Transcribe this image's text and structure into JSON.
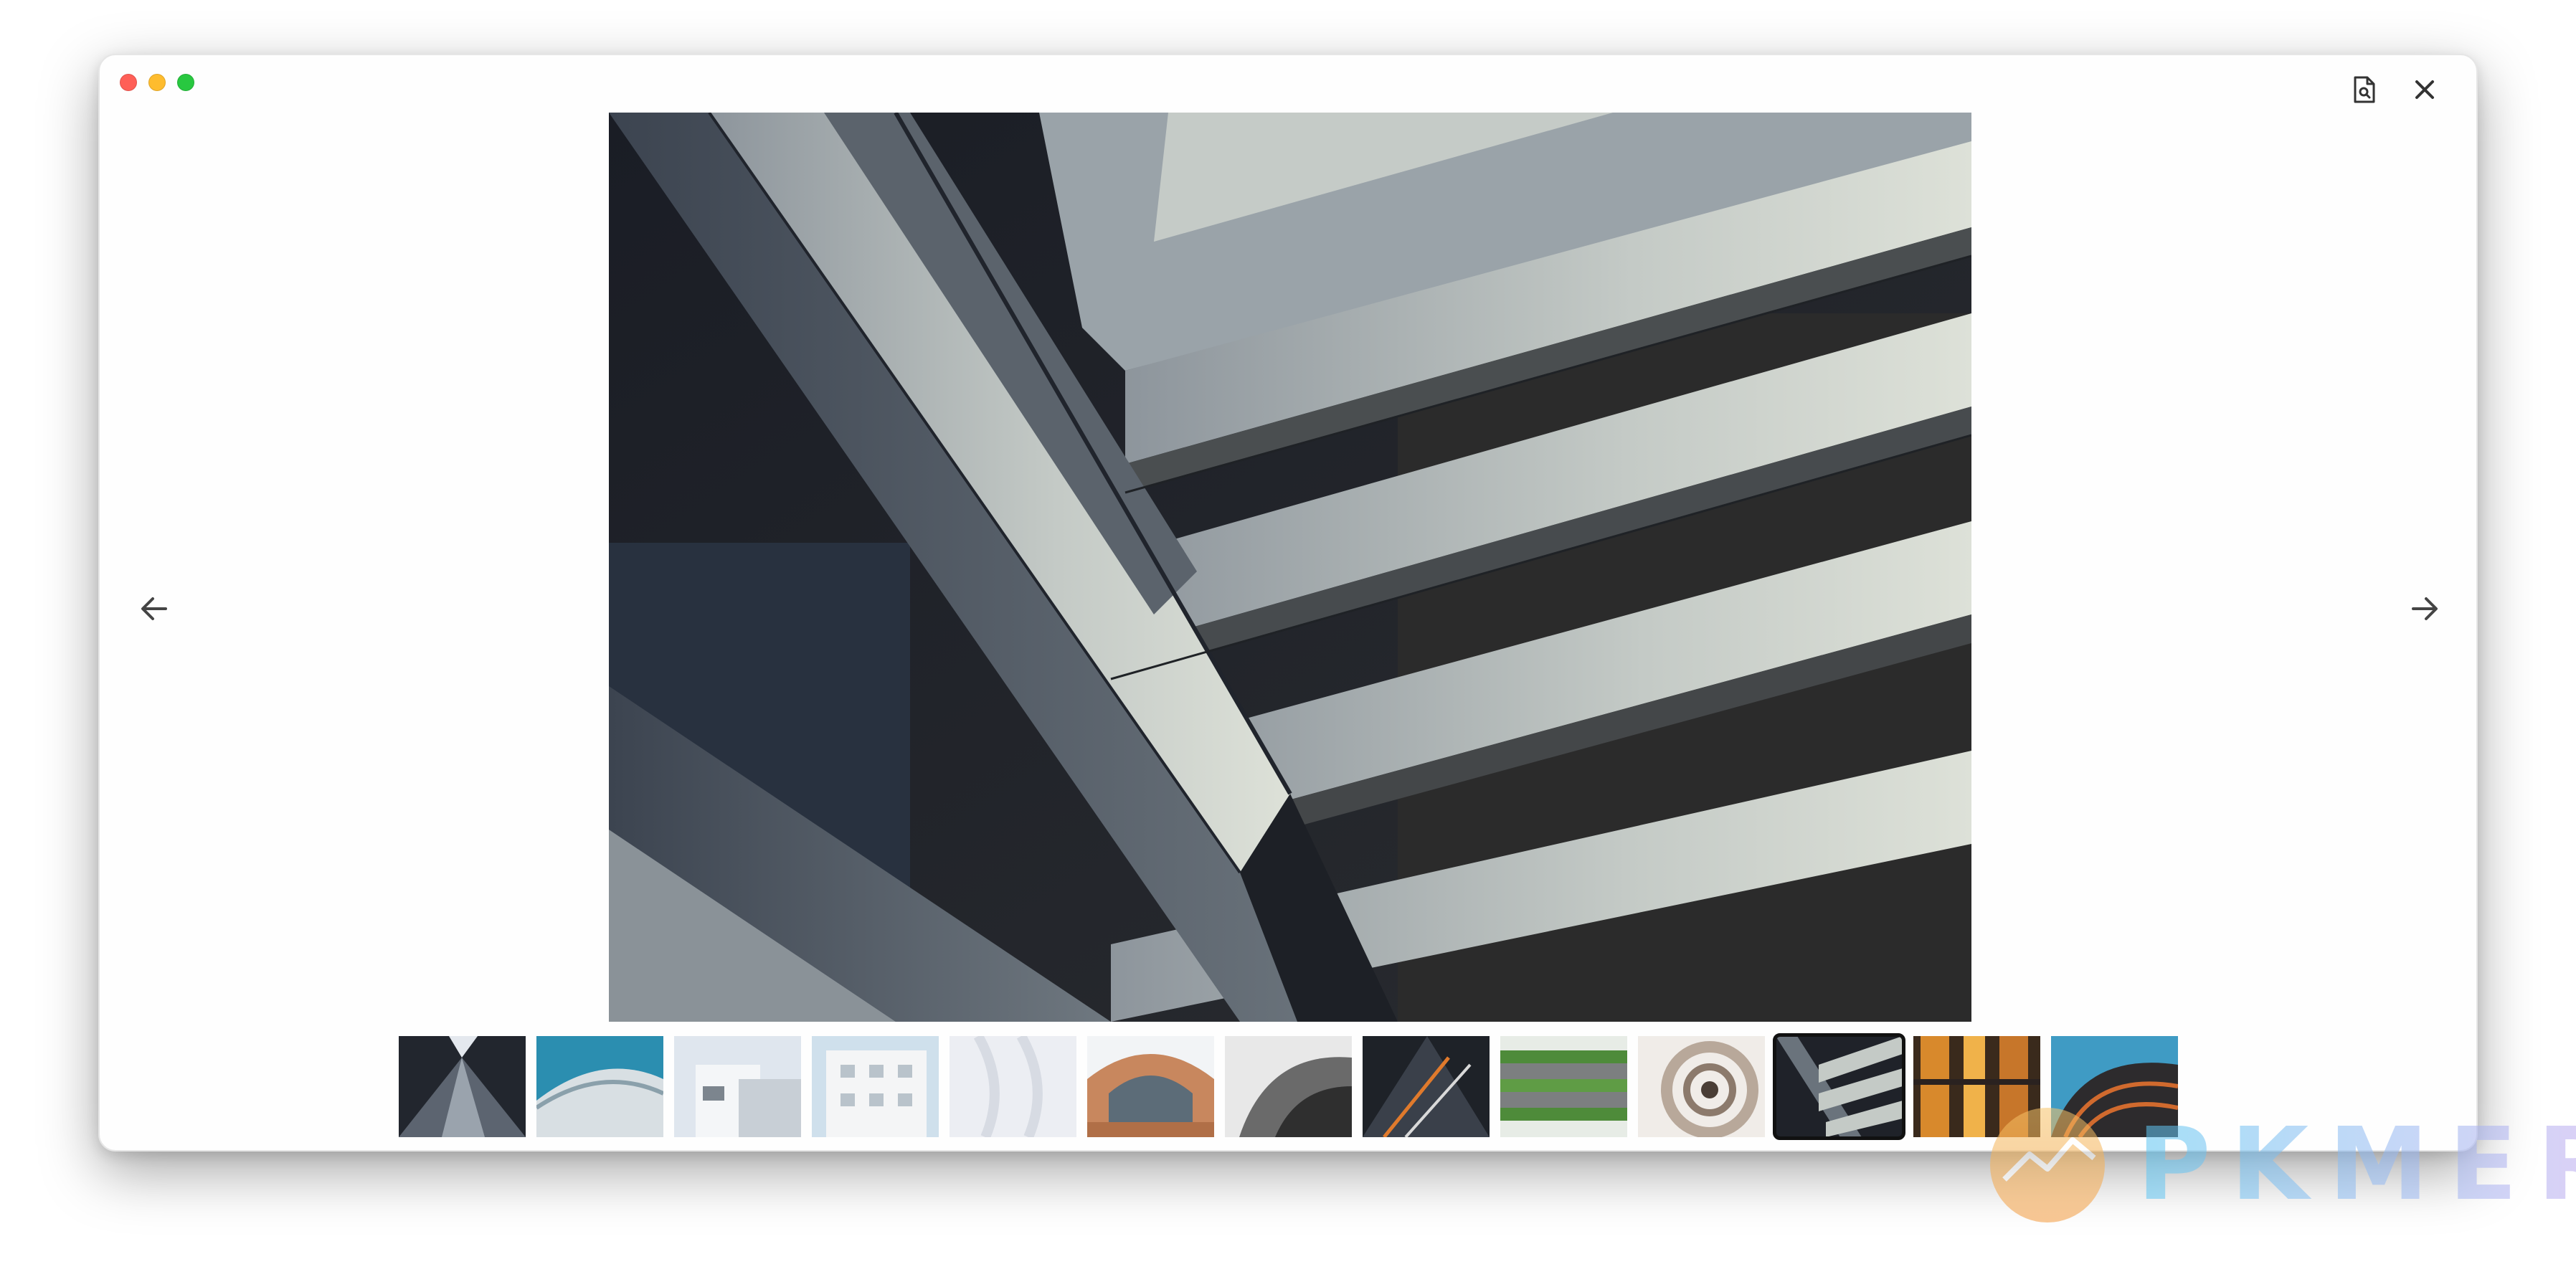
{
  "window": {
    "traffic_lights": {
      "close_color": "#ff5f57",
      "minimize_color": "#febc2e",
      "zoom_color": "#28c840"
    },
    "icons": {
      "top_left_action": "document-search-icon",
      "close": "close-icon",
      "previous": "arrow-left-icon",
      "next": "arrow-right-icon"
    }
  },
  "viewer": {
    "main_image": "building-diagonal-facade",
    "thumbnails": [
      {
        "id": "thumb-1",
        "subject": "skyscraper-looking-up",
        "selected": false
      },
      {
        "id": "thumb-2",
        "subject": "curved-blue-facade",
        "selected": false
      },
      {
        "id": "thumb-3",
        "subject": "white-modern-building",
        "selected": false
      },
      {
        "id": "thumb-4",
        "subject": "white-apartment-block",
        "selected": false
      },
      {
        "id": "thumb-5",
        "subject": "white-wavy-facade",
        "selected": false
      },
      {
        "id": "thumb-6",
        "subject": "arched-copper-building",
        "selected": false
      },
      {
        "id": "thumb-7",
        "subject": "gray-curved-walls",
        "selected": false
      },
      {
        "id": "thumb-8",
        "subject": "dark-glass-tower",
        "selected": false
      },
      {
        "id": "thumb-9",
        "subject": "green-terrace-building",
        "selected": false
      },
      {
        "id": "thumb-10",
        "subject": "spiral-staircase",
        "selected": false
      },
      {
        "id": "thumb-11",
        "subject": "building-diagonal-facade",
        "selected": true
      },
      {
        "id": "thumb-12",
        "subject": "orange-lit-windows",
        "selected": false
      },
      {
        "id": "thumb-13",
        "subject": "curved-tower-orange-blue",
        "selected": false
      }
    ]
  },
  "watermark": {
    "logo": "pkmer-logo-icon",
    "text": "PKMER",
    "gradient_start": "#5cc6f2",
    "gradient_end": "#c7a8ef"
  }
}
